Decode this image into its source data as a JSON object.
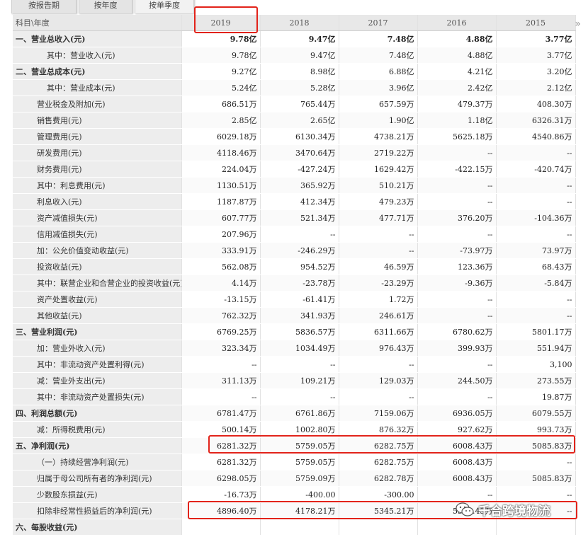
{
  "tabs": [
    "按报告期",
    "按年度",
    "按单季度"
  ],
  "header": {
    "label": "科目\\年度",
    "years": [
      "2019",
      "2018",
      "2017",
      "2016",
      "2015"
    ],
    "more_icon": "double-chevron-right-icon"
  },
  "rows": [
    {
      "label": "一、营业总收入(元)",
      "style": "top",
      "v": [
        "9.78亿",
        "9.47亿",
        "7.48亿",
        "4.88亿",
        "3.77亿"
      ]
    },
    {
      "label": "其中：营业收入(元)",
      "style": "ind2",
      "v": [
        "9.78亿",
        "9.47亿",
        "7.48亿",
        "4.88亿",
        "3.77亿"
      ]
    },
    {
      "label": "二、营业总成本(元)",
      "style": "top",
      "v": [
        "9.27亿",
        "8.98亿",
        "6.88亿",
        "4.21亿",
        "3.20亿"
      ]
    },
    {
      "label": "其中：营业成本(元)",
      "style": "ind2",
      "v": [
        "5.24亿",
        "5.28亿",
        "3.96亿",
        "2.42亿",
        "2.12亿"
      ]
    },
    {
      "label": "营业税金及附加(元)",
      "style": "ind1",
      "v": [
        "686.51万",
        "765.44万",
        "657.59万",
        "479.37万",
        "408.30万"
      ]
    },
    {
      "label": "销售费用(元)",
      "style": "ind1",
      "v": [
        "2.85亿",
        "2.65亿",
        "1.90亿",
        "1.18亿",
        "6326.31万"
      ]
    },
    {
      "label": "管理费用(元)",
      "style": "ind1",
      "v": [
        "6029.18万",
        "6130.34万",
        "4738.21万",
        "5625.18万",
        "4540.86万"
      ]
    },
    {
      "label": "研发费用(元)",
      "style": "ind1",
      "v": [
        "4118.46万",
        "3470.64万",
        "2719.22万",
        "--",
        "--"
      ]
    },
    {
      "label": "财务费用(元)",
      "style": "ind1",
      "v": [
        "224.04万",
        "-427.24万",
        "1629.42万",
        "-422.15万",
        "-420.74万"
      ]
    },
    {
      "label": "其中：利息费用(元)",
      "style": "ind1",
      "v": [
        "1130.51万",
        "365.92万",
        "510.21万",
        "--",
        "--"
      ]
    },
    {
      "label": "利息收入(元)",
      "style": "ind1",
      "v": [
        "1187.87万",
        "412.34万",
        "479.23万",
        "--",
        "--"
      ]
    },
    {
      "label": "资产减值损失(元)",
      "style": "ind1",
      "v": [
        "607.77万",
        "521.34万",
        "477.71万",
        "376.20万",
        "-104.36万"
      ]
    },
    {
      "label": "信用减值损失(元)",
      "style": "ind1",
      "v": [
        "207.96万",
        "--",
        "--",
        "--",
        "--"
      ]
    },
    {
      "label": "加：公允价值变动收益(元)",
      "style": "ind1",
      "v": [
        "333.91万",
        "-246.29万",
        "--",
        "-73.97万",
        "73.97万"
      ]
    },
    {
      "label": "投资收益(元)",
      "style": "ind1",
      "v": [
        "562.08万",
        "954.52万",
        "46.59万",
        "123.36万",
        "68.43万"
      ]
    },
    {
      "label": "其中：联营企业和合营企业的投资收益(元)",
      "style": "ind1",
      "v": [
        "4.14万",
        "-23.78万",
        "-23.29万",
        "-9.36万",
        "-5.84万"
      ]
    },
    {
      "label": "资产处置收益(元)",
      "style": "ind1",
      "v": [
        "-13.15万",
        "-61.41万",
        "1.72万",
        "--",
        "--"
      ]
    },
    {
      "label": "其他收益(元)",
      "style": "ind1",
      "v": [
        "762.32万",
        "341.93万",
        "246.61万",
        "--",
        "--"
      ]
    },
    {
      "label": "三、营业利润(元)",
      "style": "top",
      "v": [
        "6769.25万",
        "5836.57万",
        "6311.66万",
        "6780.62万",
        "5801.17万"
      ]
    },
    {
      "label": "加：营业外收入(元)",
      "style": "ind1",
      "v": [
        "323.34万",
        "1034.49万",
        "976.43万",
        "399.93万",
        "551.94万"
      ]
    },
    {
      "label": "其中：非流动资产处置利得(元)",
      "style": "ind1",
      "v": [
        "--",
        "--",
        "--",
        "--",
        "3,100"
      ]
    },
    {
      "label": "减：营业外支出(元)",
      "style": "ind1",
      "v": [
        "311.13万",
        "109.21万",
        "129.03万",
        "244.50万",
        "273.55万"
      ]
    },
    {
      "label": "其中：非流动资产处置损失(元)",
      "style": "ind1",
      "v": [
        "--",
        "--",
        "--",
        "--",
        "19.87万"
      ]
    },
    {
      "label": "四、利润总额(元)",
      "style": "top",
      "v": [
        "6781.47万",
        "6761.86万",
        "7159.06万",
        "6936.05万",
        "6079.55万"
      ]
    },
    {
      "label": "减：所得税费用(元)",
      "style": "ind1",
      "v": [
        "500.14万",
        "1002.80万",
        "876.32万",
        "927.62万",
        "993.73万"
      ]
    },
    {
      "label": "五、净利润(元)",
      "style": "top",
      "v": [
        "6281.32万",
        "5759.05万",
        "6282.75万",
        "6008.43万",
        "5085.83万"
      ]
    },
    {
      "label": "（一）持续经营净利润(元)",
      "style": "ind1",
      "v": [
        "6281.32万",
        "5759.05万",
        "6282.75万",
        "6008.43万",
        "--"
      ]
    },
    {
      "label": "归属于母公司所有者的净利润(元)",
      "style": "ind1",
      "v": [
        "6298.05万",
        "5759.09万",
        "6282.78万",
        "6008.43万",
        "5085.83万"
      ]
    },
    {
      "label": "少数股东损益(元)",
      "style": "ind1",
      "v": [
        "-16.73万",
        "-400.00",
        "-300.00",
        "--",
        "--"
      ]
    },
    {
      "label": "扣除非经常性损益后的净利润(元)",
      "style": "ind1",
      "v": [
        "4896.40万",
        "4178.21万",
        "5345.21万",
        "5343.43万",
        "--"
      ]
    },
    {
      "label": "六、每股收益(元)",
      "style": "top",
      "v": [
        "",
        "",
        "",
        "",
        ""
      ]
    }
  ],
  "watermark": "千合跨境物流",
  "colors": {
    "highlight": "#e2231a",
    "label_bg": "#ededed",
    "header_bg": "#e8e8e8"
  }
}
